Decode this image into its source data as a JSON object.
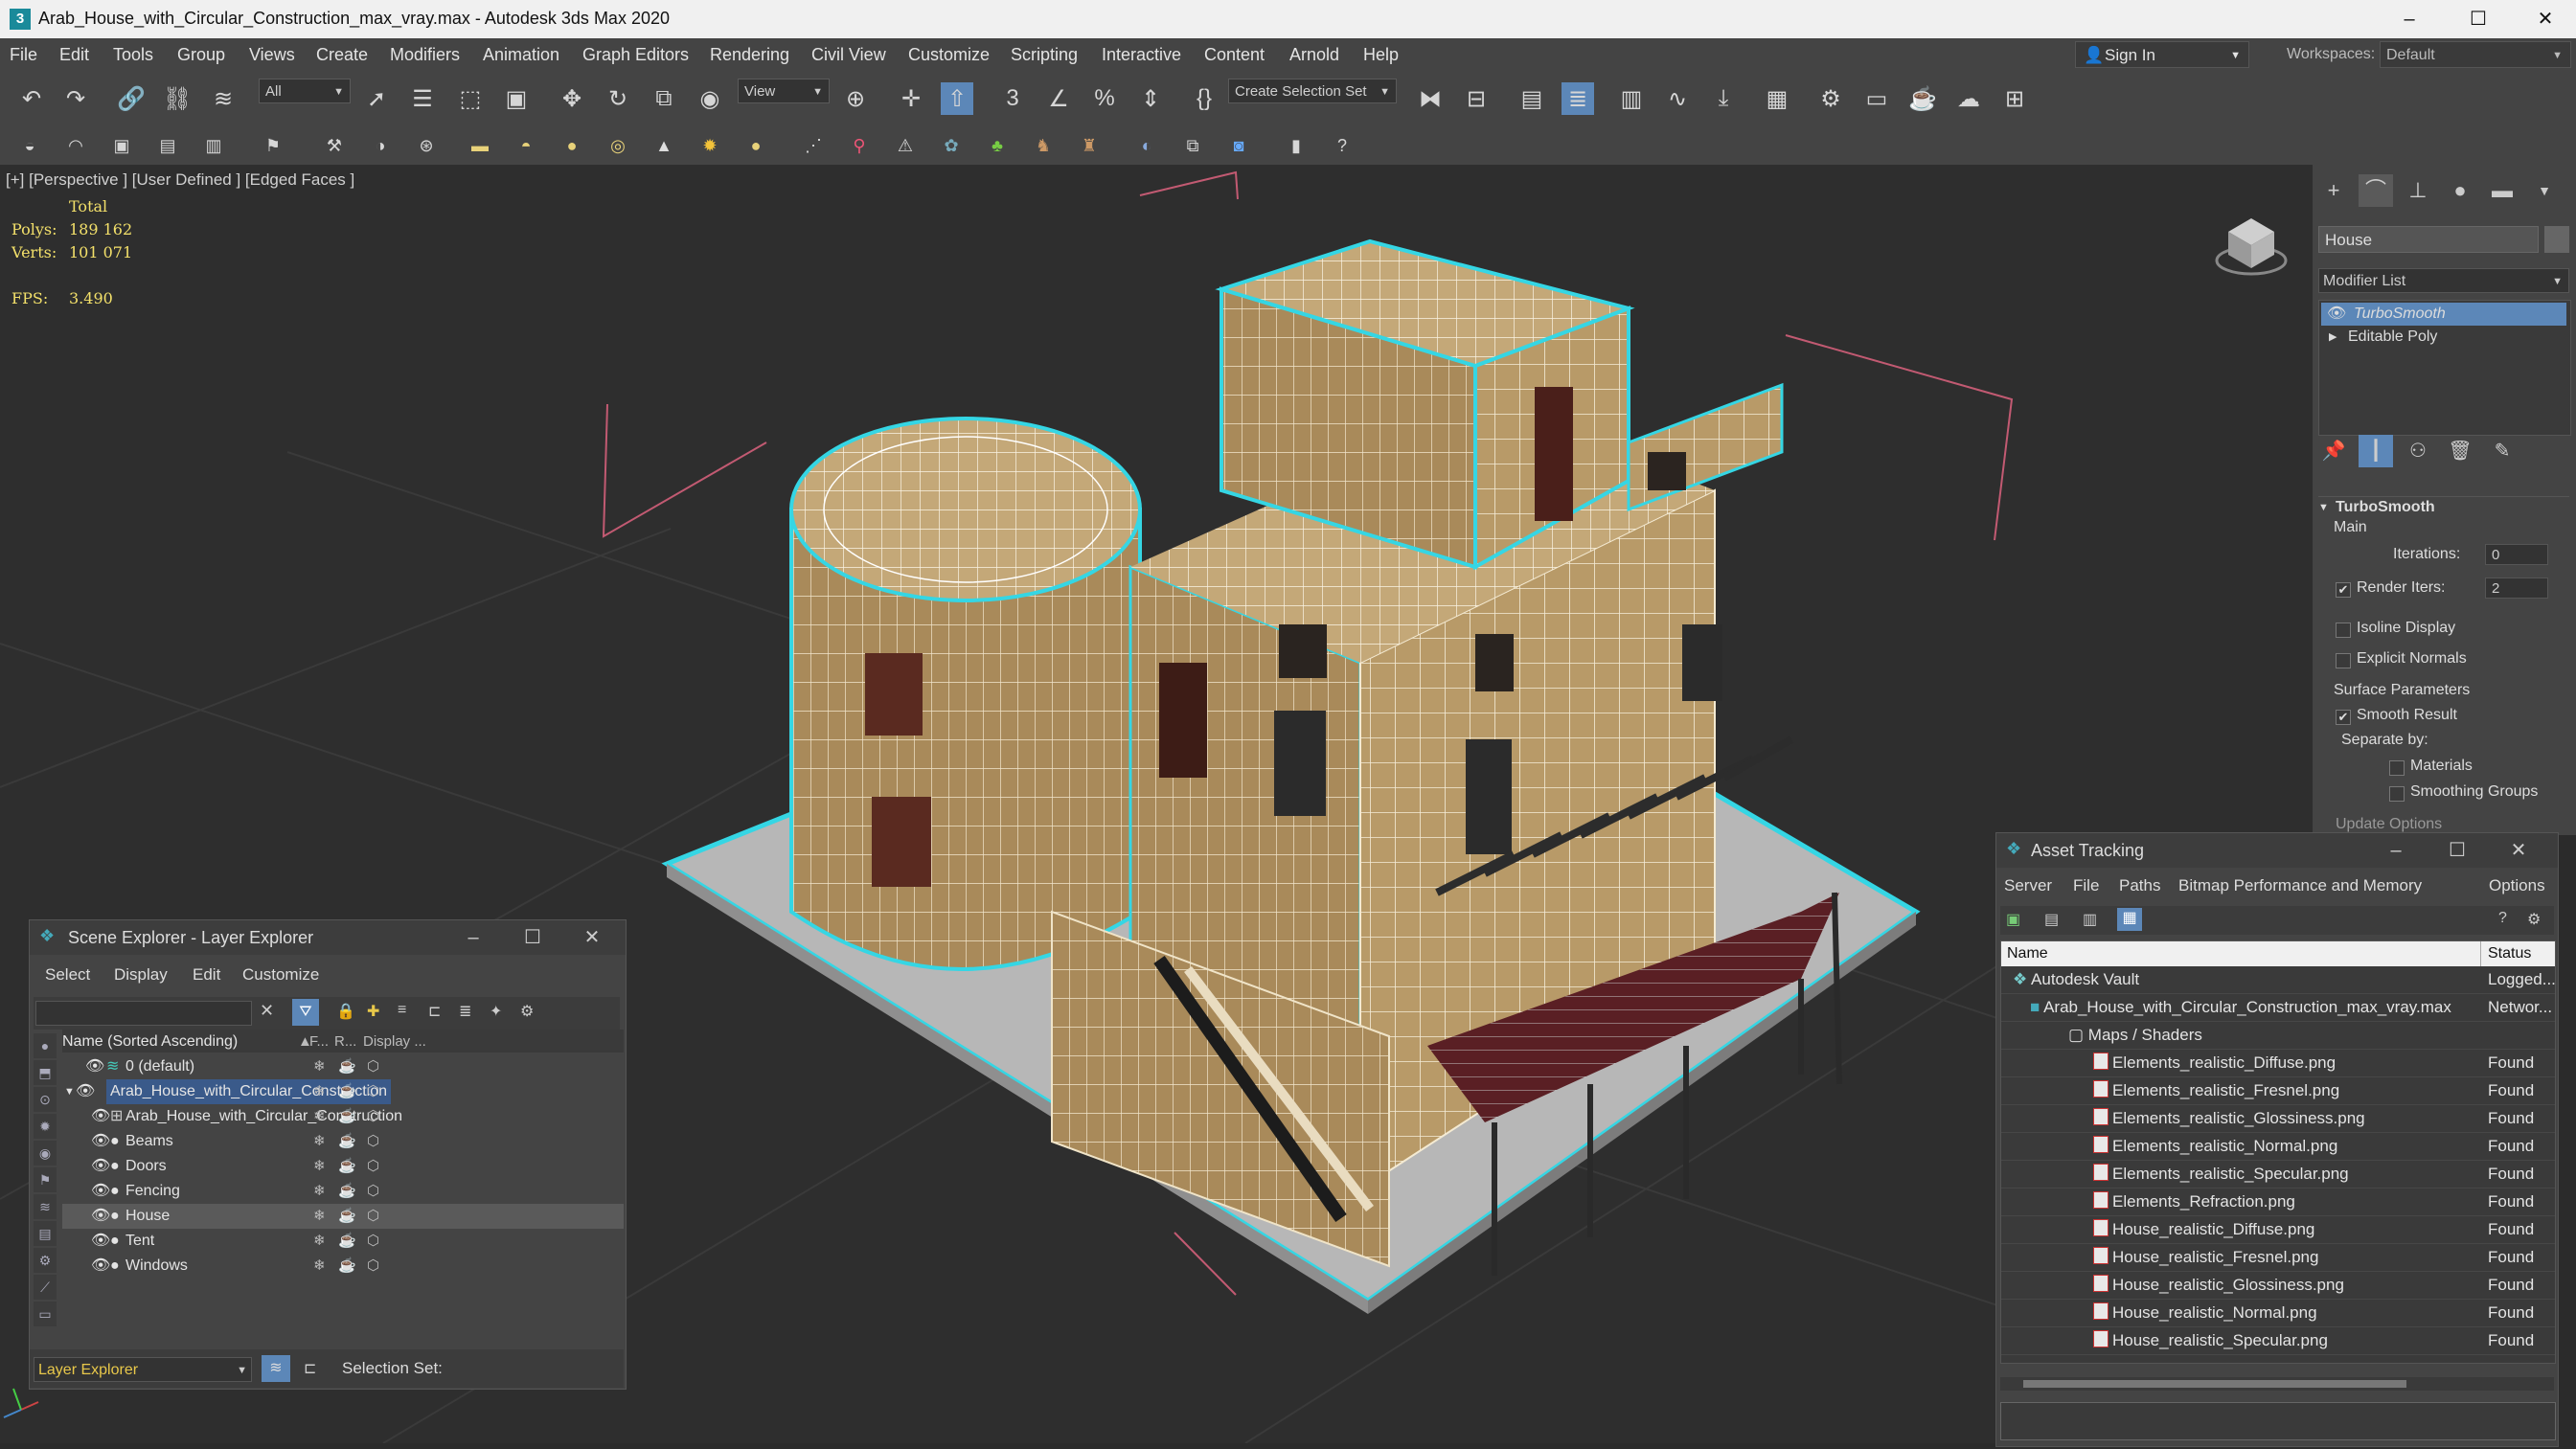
{
  "window": {
    "title": "Arab_House_with_Circular_Construction_max_vray.max - Autodesk 3ds Max 2020",
    "min": "–",
    "max": "☐",
    "close": "✕"
  },
  "menu": [
    "File",
    "Edit",
    "Tools",
    "Group",
    "Views",
    "Create",
    "Modifiers",
    "Animation",
    "Graph Editors",
    "Rendering",
    "Civil View",
    "Customize",
    "Scripting",
    "Interactive",
    "Content",
    "Arnold",
    "Help"
  ],
  "signin": "Sign In",
  "workspaces": {
    "label": "Workspaces:",
    "value": "Default"
  },
  "toolbar": {
    "filter_select": "All",
    "view_select": "View",
    "selection_set": "Create Selection Set",
    "zoom_snap": "3"
  },
  "viewport": {
    "label": "[+] [Perspective ] [User Defined ] [Edged Faces ]",
    "total_label": "Total",
    "polys_label": "Polys:",
    "polys_value": "189 162",
    "verts_label": "Verts:",
    "verts_value": "101 071",
    "fps_label": "FPS:",
    "fps_value": "3.490"
  },
  "command_panel": {
    "object_name": "House",
    "modifier_list": "Modifier List",
    "stack": [
      "TurboSmooth",
      "Editable Poly"
    ],
    "rollout_title": "TurboSmooth",
    "main_label": "Main",
    "iterations_label": "Iterations:",
    "iterations_value": "0",
    "render_iters_label": "Render Iters:",
    "render_iters_value": "2",
    "isoline": "Isoline Display",
    "explicit_normals": "Explicit Normals",
    "surface_params": "Surface Parameters",
    "smooth_result": "Smooth Result",
    "separate_by": "Separate by:",
    "materials": "Materials",
    "smoothing_groups": "Smoothing Groups",
    "update_options": "Update Options"
  },
  "asset_tracking": {
    "title": "Asset Tracking",
    "menu": [
      "Server",
      "File",
      "Paths",
      "Bitmap Performance and Memory",
      "Options"
    ],
    "col_name": "Name",
    "col_status": "Status",
    "rows": [
      {
        "name": "Autodesk Vault",
        "status": "Logged..."
      },
      {
        "name": "Arab_House_with_Circular_Construction_max_vray.max",
        "status": "Networ..."
      },
      {
        "name": "Maps / Shaders",
        "status": ""
      },
      {
        "name": "Elements_realistic_Diffuse.png",
        "status": "Found"
      },
      {
        "name": "Elements_realistic_Fresnel.png",
        "status": "Found"
      },
      {
        "name": "Elements_realistic_Glossiness.png",
        "status": "Found"
      },
      {
        "name": "Elements_realistic_Normal.png",
        "status": "Found"
      },
      {
        "name": "Elements_realistic_Specular.png",
        "status": "Found"
      },
      {
        "name": "Elements_Refraction.png",
        "status": "Found"
      },
      {
        "name": "House_realistic_Diffuse.png",
        "status": "Found"
      },
      {
        "name": "House_realistic_Fresnel.png",
        "status": "Found"
      },
      {
        "name": "House_realistic_Glossiness.png",
        "status": "Found"
      },
      {
        "name": "House_realistic_Normal.png",
        "status": "Found"
      },
      {
        "name": "House_realistic_Specular.png",
        "status": "Found"
      }
    ]
  },
  "scene_explorer": {
    "title": "Scene Explorer - Layer Explorer",
    "menu": [
      "Select",
      "Display",
      "Edit",
      "Customize"
    ],
    "col_name": "Name (Sorted Ascending)",
    "col_f": "F...",
    "col_r": "R...",
    "col_display": "Display ...",
    "rows": [
      {
        "label": "0 (default)"
      },
      {
        "label": "Arab_House_with_Circular_Construction"
      },
      {
        "label": "Arab_House_with_Circular_Construction"
      },
      {
        "label": "Beams"
      },
      {
        "label": "Doors"
      },
      {
        "label": "Fencing"
      },
      {
        "label": "House"
      },
      {
        "label": "Tent"
      },
      {
        "label": "Windows"
      }
    ],
    "footer_select": "Layer Explorer",
    "selection_set_label": "Selection Set:"
  }
}
